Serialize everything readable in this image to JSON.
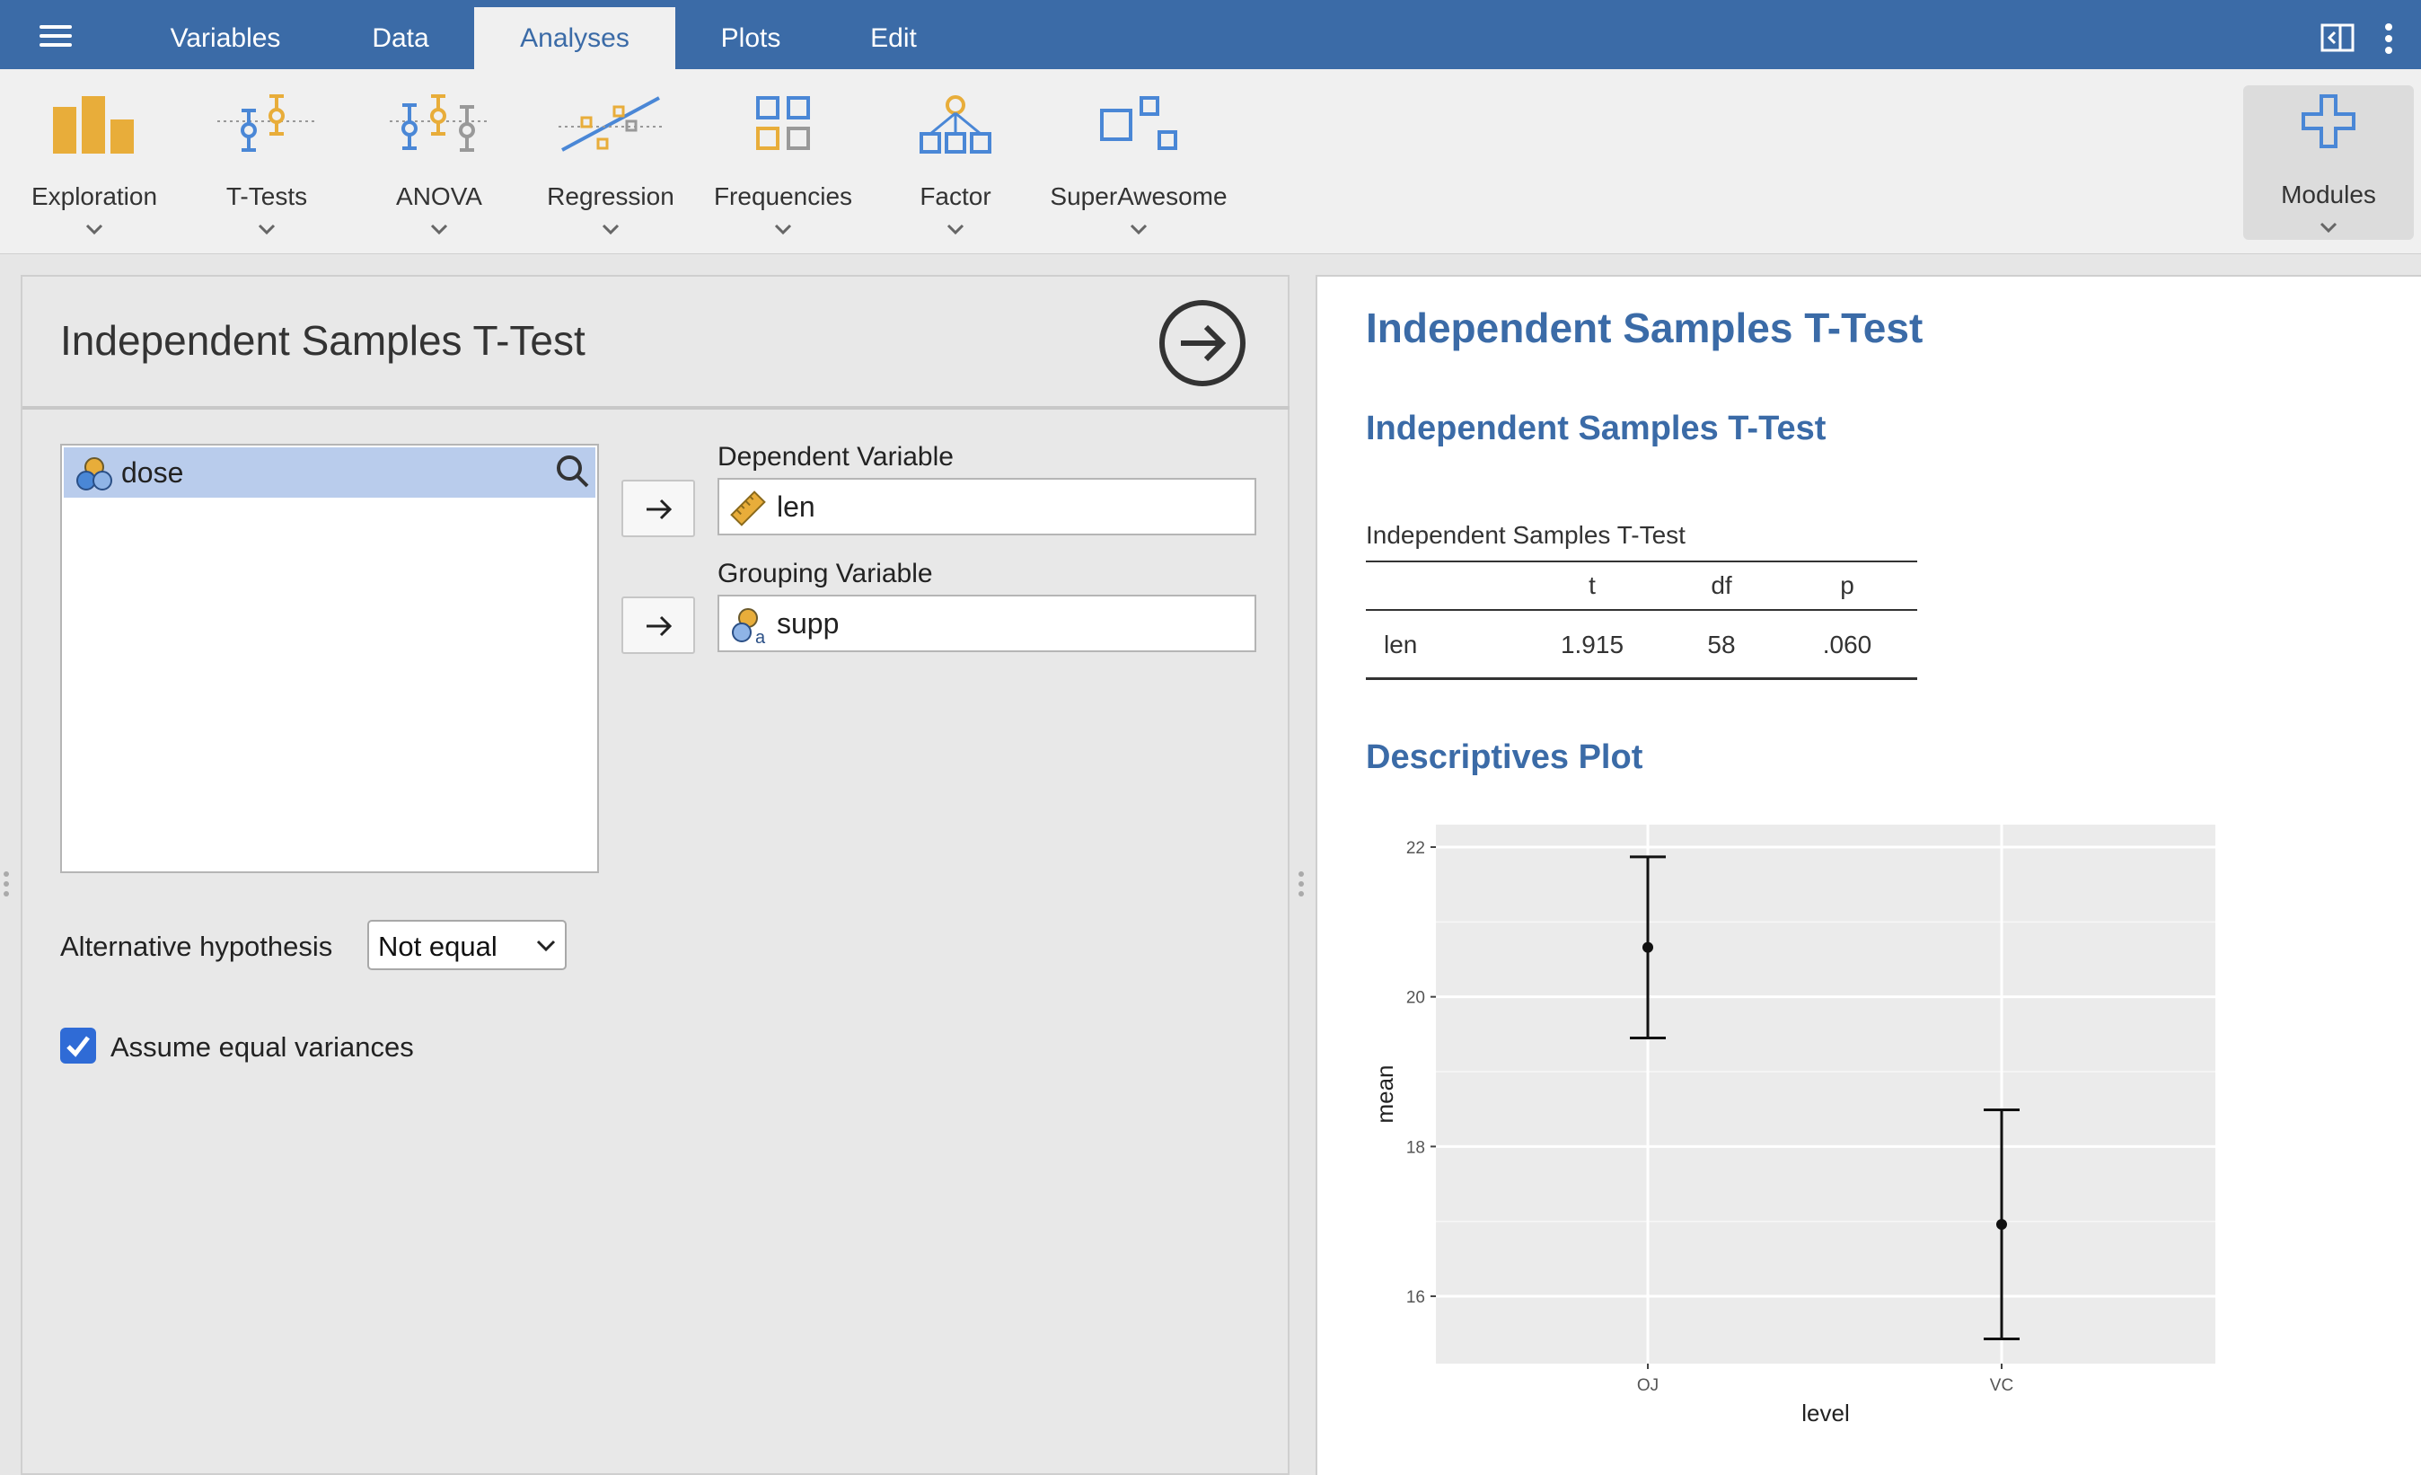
{
  "menubar": {
    "tabs": [
      "Variables",
      "Data",
      "Analyses",
      "Plots",
      "Edit"
    ],
    "active_tab": "Analyses"
  },
  "ribbon": {
    "buttons": [
      {
        "label": "Exploration",
        "icon": "exploration-icon"
      },
      {
        "label": "T-Tests",
        "icon": "t-tests-icon"
      },
      {
        "label": "ANOVA",
        "icon": "anova-icon"
      },
      {
        "label": "Regression",
        "icon": "regression-icon"
      },
      {
        "label": "Frequencies",
        "icon": "frequencies-icon"
      },
      {
        "label": "Factor",
        "icon": "factor-icon"
      },
      {
        "label": "SuperAwesome",
        "icon": "superawesome-icon"
      }
    ],
    "modules_label": "Modules"
  },
  "options": {
    "title": "Independent Samples T-Test",
    "variables": [
      {
        "name": "dose",
        "type": "nominal"
      }
    ],
    "dependent_label": "Dependent Variable",
    "dependent_value": "len",
    "grouping_label": "Grouping Variable",
    "grouping_value": "supp",
    "alt_hypothesis_label": "Alternative hypothesis",
    "alt_hypothesis_value": "Not equal",
    "equal_var_label": "Assume equal variances",
    "equal_var_checked": true
  },
  "results": {
    "title": "Independent Samples T-Test",
    "subtitle": "Independent Samples T-Test",
    "table": {
      "title": "Independent Samples T-Test",
      "columns": [
        "",
        "t",
        "df",
        "p"
      ],
      "rows": [
        [
          "len",
          "1.915",
          "58",
          ".060"
        ]
      ]
    },
    "plot_title": "Descriptives Plot"
  },
  "colors": {
    "brand": "#3b6ba7",
    "accent_orange": "#e8ad3a",
    "accent_blue": "#4a87d6",
    "checkbox": "#2f6bd6"
  },
  "chart_data": {
    "type": "scatter",
    "title": "",
    "xlabel": "level",
    "ylabel": "mean",
    "categories": [
      "OJ",
      "VC"
    ],
    "values": [
      20.66,
      16.96
    ],
    "error_low": [
      19.45,
      15.43
    ],
    "error_high": [
      21.87,
      18.49
    ],
    "ylim": [
      15.1,
      22.3
    ],
    "yticks": [
      16,
      18,
      20,
      22
    ],
    "grid": true
  }
}
